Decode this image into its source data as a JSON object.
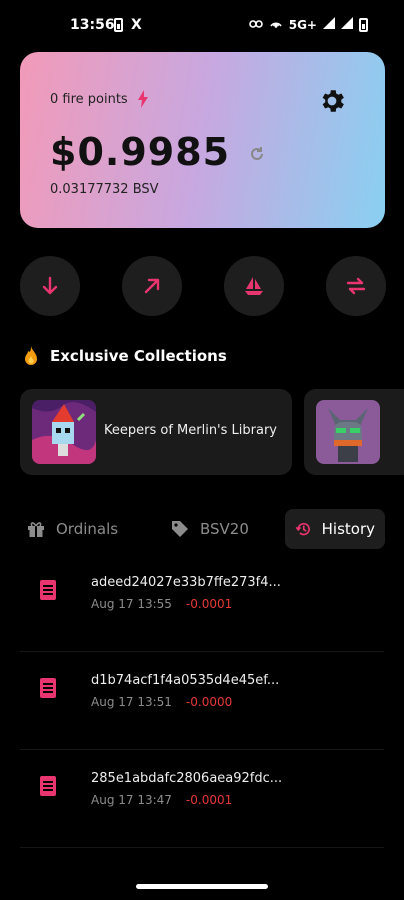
{
  "status_bar": {
    "time": "13:56",
    "network": "5G+"
  },
  "wallet": {
    "fire_points": "0 fire points",
    "balance_usd": "$0.9985",
    "balance_bsv": "0.03177732 BSV"
  },
  "colors": {
    "accent": "#e8356f",
    "card_start": "#f29ab8",
    "card_end": "#89d0f1",
    "negative": "#e53935"
  },
  "actions": [
    {
      "icon": "arrow-down-icon"
    },
    {
      "icon": "arrow-up-right-icon"
    },
    {
      "icon": "sailboat-icon"
    },
    {
      "icon": "swap-icon"
    }
  ],
  "collections_section": {
    "title": "Exclusive Collections"
  },
  "collections": [
    {
      "name": "Keepers of Merlin's Library"
    },
    {
      "name": ""
    }
  ],
  "tabs": [
    {
      "label": "Ordinals",
      "icon": "gift-icon"
    },
    {
      "label": "BSV20",
      "icon": "tag-icon"
    },
    {
      "label": "History",
      "icon": "history-icon",
      "active": true
    }
  ],
  "history": [
    {
      "hash": "adeed24027e33b7ffe273f4...",
      "date": "Aug 17 13:55",
      "amount": "-0.0001"
    },
    {
      "hash": "d1b74acf1f4a0535d4e45ef...",
      "date": "Aug 17 13:51",
      "amount": "-0.0000"
    },
    {
      "hash": "285e1abdafc2806aea92fdc...",
      "date": "Aug 17 13:47",
      "amount": "-0.0001"
    }
  ]
}
